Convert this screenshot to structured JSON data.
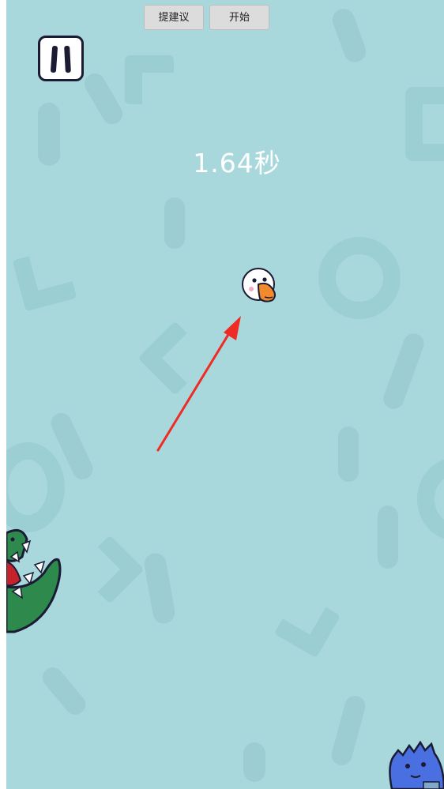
{
  "toolbar": {
    "suggest_label": "提建议",
    "start_label": "开始"
  },
  "game": {
    "timer_value": "1.64",
    "timer_unit": "秒",
    "background_color": "#a9d8dc",
    "arrow_color": "#ee2b24"
  },
  "icons": {
    "pause": "pause-icon",
    "player": "goose-head",
    "enemy_left": "crocodile",
    "enemy_bottom_right": "blue-monster"
  }
}
